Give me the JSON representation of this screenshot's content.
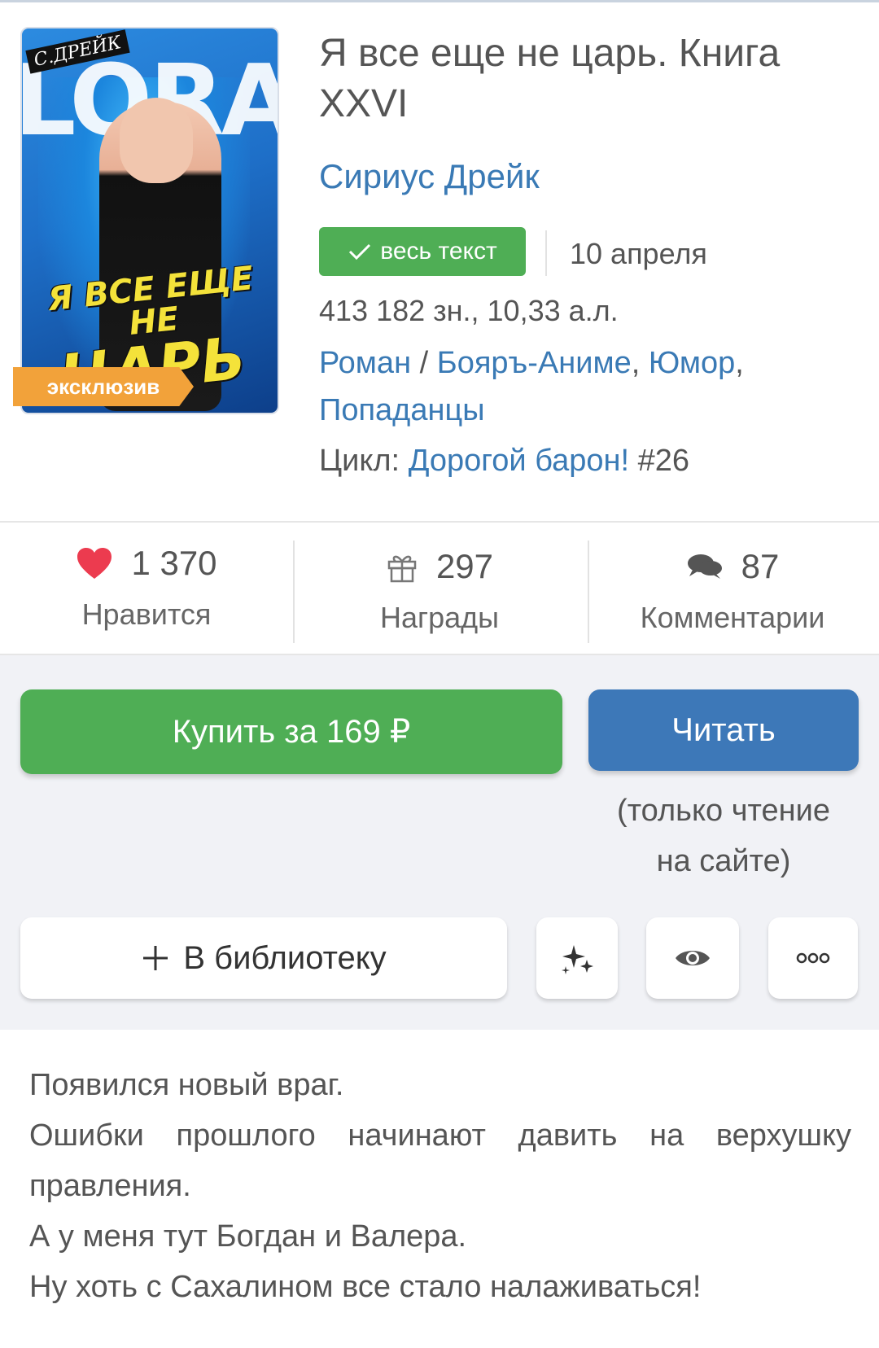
{
  "book": {
    "title": "Я все еще не царь. Книга XXVI",
    "author": "Сириус Дрейк",
    "status_badge": "весь текст",
    "date": "10 апреля",
    "size": "413 182 зн., 10,33 а.л.",
    "genres": [
      "Роман",
      "Бояръ-Аниме",
      "Юмор",
      "Попаданцы"
    ],
    "cycle_label": "Цикл:",
    "cycle_name": "Дорогой барон!",
    "cycle_number": "#26",
    "cover": {
      "author_tag": "С.ДРЕЙК",
      "big_letters": "LORA",
      "title_line1": "Я ВСЕ ЕЩЕ НЕ",
      "title_line2": "ЦАРЬ",
      "exclusive_label": "эксклюзив"
    }
  },
  "stats": {
    "likes": {
      "value": "1 370",
      "label": "Нравится"
    },
    "awards": {
      "value": "297",
      "label": "Награды"
    },
    "comments": {
      "value": "87",
      "label": "Комментарии"
    }
  },
  "actions": {
    "buy_label": "Купить за 169 ₽",
    "read_label": "Читать",
    "read_note_line1": "(только чтение",
    "read_note_line2": "на сайте)",
    "library_label": "В библиотеку"
  },
  "description": {
    "lines": [
      "Появился новый враг.",
      "Ошибки прошлого начинают давить на верхушку",
      "правления.",
      "А у меня тут Богдан и Валера.",
      "Ну хоть с Сахалином все стало налаживаться!"
    ]
  },
  "colors": {
    "green": "#4fae55",
    "blue_button": "#3d78b8",
    "link": "#3a7ab5",
    "heart": "#ec3b4f",
    "exclusive": "#f2a23a"
  },
  "icons": [
    "heart-icon",
    "gift-icon",
    "comments-icon",
    "check-icon",
    "plus-icon",
    "sparkles-icon",
    "eye-icon",
    "more-icon"
  ]
}
